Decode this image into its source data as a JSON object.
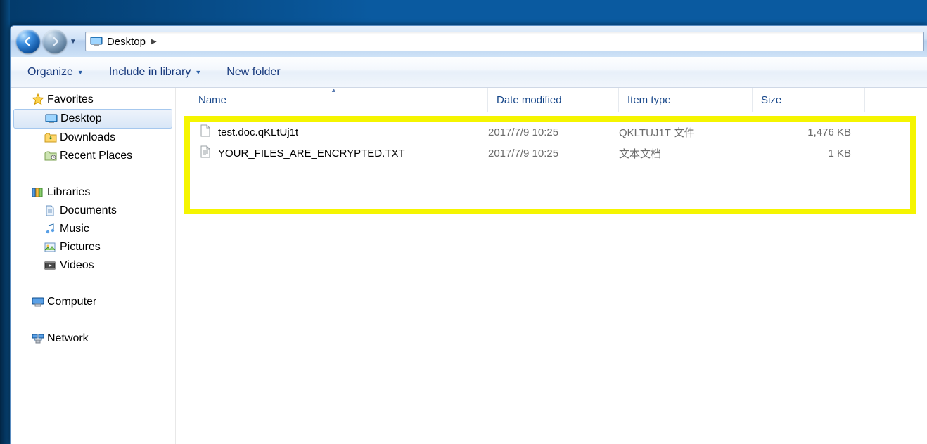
{
  "address": {
    "location": "Desktop"
  },
  "toolbar": {
    "organize": "Organize",
    "include": "Include in library",
    "newfolder": "New folder"
  },
  "sidebar": {
    "favorites": {
      "label": "Favorites",
      "items": [
        {
          "label": "Desktop"
        },
        {
          "label": "Downloads"
        },
        {
          "label": "Recent Places"
        }
      ]
    },
    "libraries": {
      "label": "Libraries",
      "items": [
        {
          "label": "Documents"
        },
        {
          "label": "Music"
        },
        {
          "label": "Pictures"
        },
        {
          "label": "Videos"
        }
      ]
    },
    "computer": {
      "label": "Computer"
    },
    "network": {
      "label": "Network"
    }
  },
  "columns": {
    "name": "Name",
    "date": "Date modified",
    "type": "Item type",
    "size": "Size"
  },
  "files": [
    {
      "name": "test.doc.qKLtUj1t",
      "date": "2017/7/9 10:25",
      "type": "QKLTUJ1T 文件",
      "size": "1,476 KB"
    },
    {
      "name": "YOUR_FILES_ARE_ENCRYPTED.TXT",
      "date": "2017/7/9 10:25",
      "type": "文本文档",
      "size": "1 KB"
    }
  ]
}
